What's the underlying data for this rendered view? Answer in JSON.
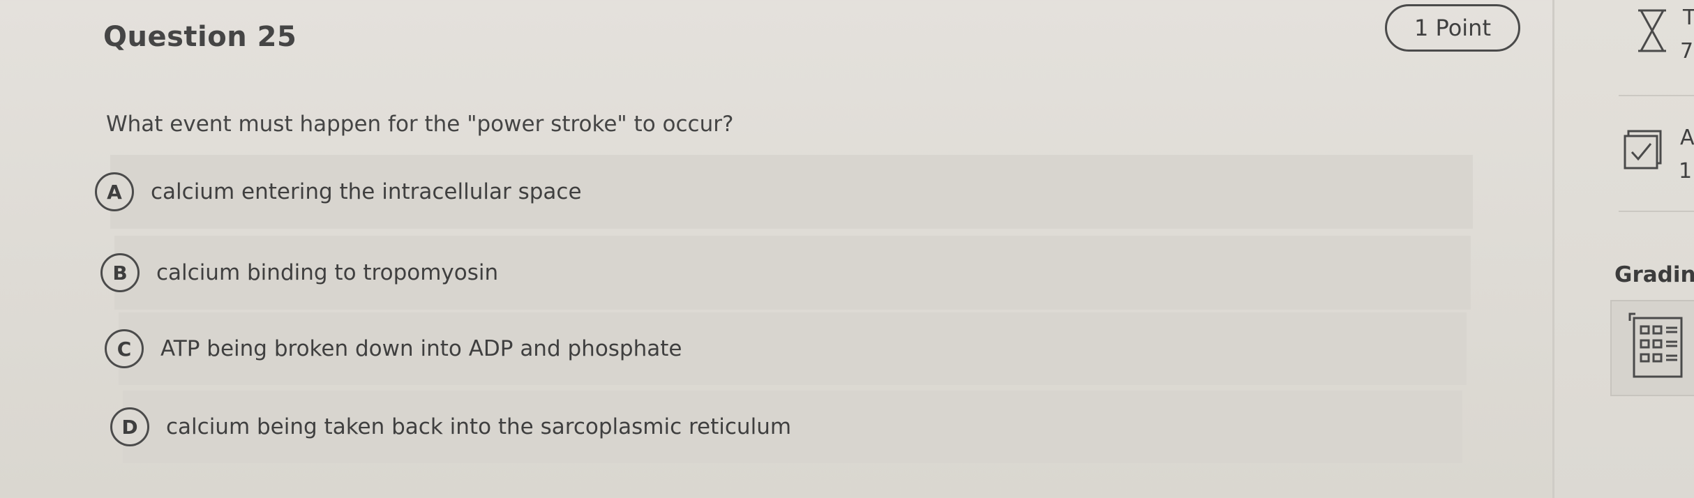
{
  "question": {
    "title": "Question 25",
    "points": "1 Point",
    "prompt": "What event must happen for the \"power stroke\" to occur?",
    "options": [
      {
        "letter": "A",
        "text": "calcium entering the intracellular space"
      },
      {
        "letter": "B",
        "text": "calcium binding to tropomyosin"
      },
      {
        "letter": "C",
        "text": "ATP being broken down into ADP and phosphate"
      },
      {
        "letter": "D",
        "text": "calcium being taken back into the sarcoplasmic reticulum"
      }
    ]
  },
  "sidebar": {
    "timer_label": "T",
    "timer_value": "7",
    "attempts_label": "A",
    "attempts_value": "1",
    "grading_label": "Gradin"
  },
  "icons": {
    "timer": "hourglass-icon",
    "attempts": "checkbox-icon",
    "grading": "calculator-grid-icon"
  }
}
